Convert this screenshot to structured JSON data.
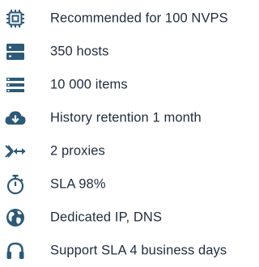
{
  "colors": {
    "icon": "#2c5a78",
    "text": "#1f2d3d"
  },
  "features": [
    {
      "icon": "cpu-chip-icon",
      "label": "Recommended for 100 NVPS"
    },
    {
      "icon": "server-icon",
      "label": "350 hosts"
    },
    {
      "icon": "list-icon",
      "label": "10 000 items"
    },
    {
      "icon": "cloud-download-icon",
      "label": "History retention 1 month"
    },
    {
      "icon": "proxy-arrows-icon",
      "label": "2 proxies"
    },
    {
      "icon": "stopwatch-icon",
      "label": "SLA 98%"
    },
    {
      "icon": "globe-icon",
      "label": "Dedicated IP, DNS"
    },
    {
      "icon": "headset-icon",
      "label": "Support SLA 4 business days"
    }
  ]
}
